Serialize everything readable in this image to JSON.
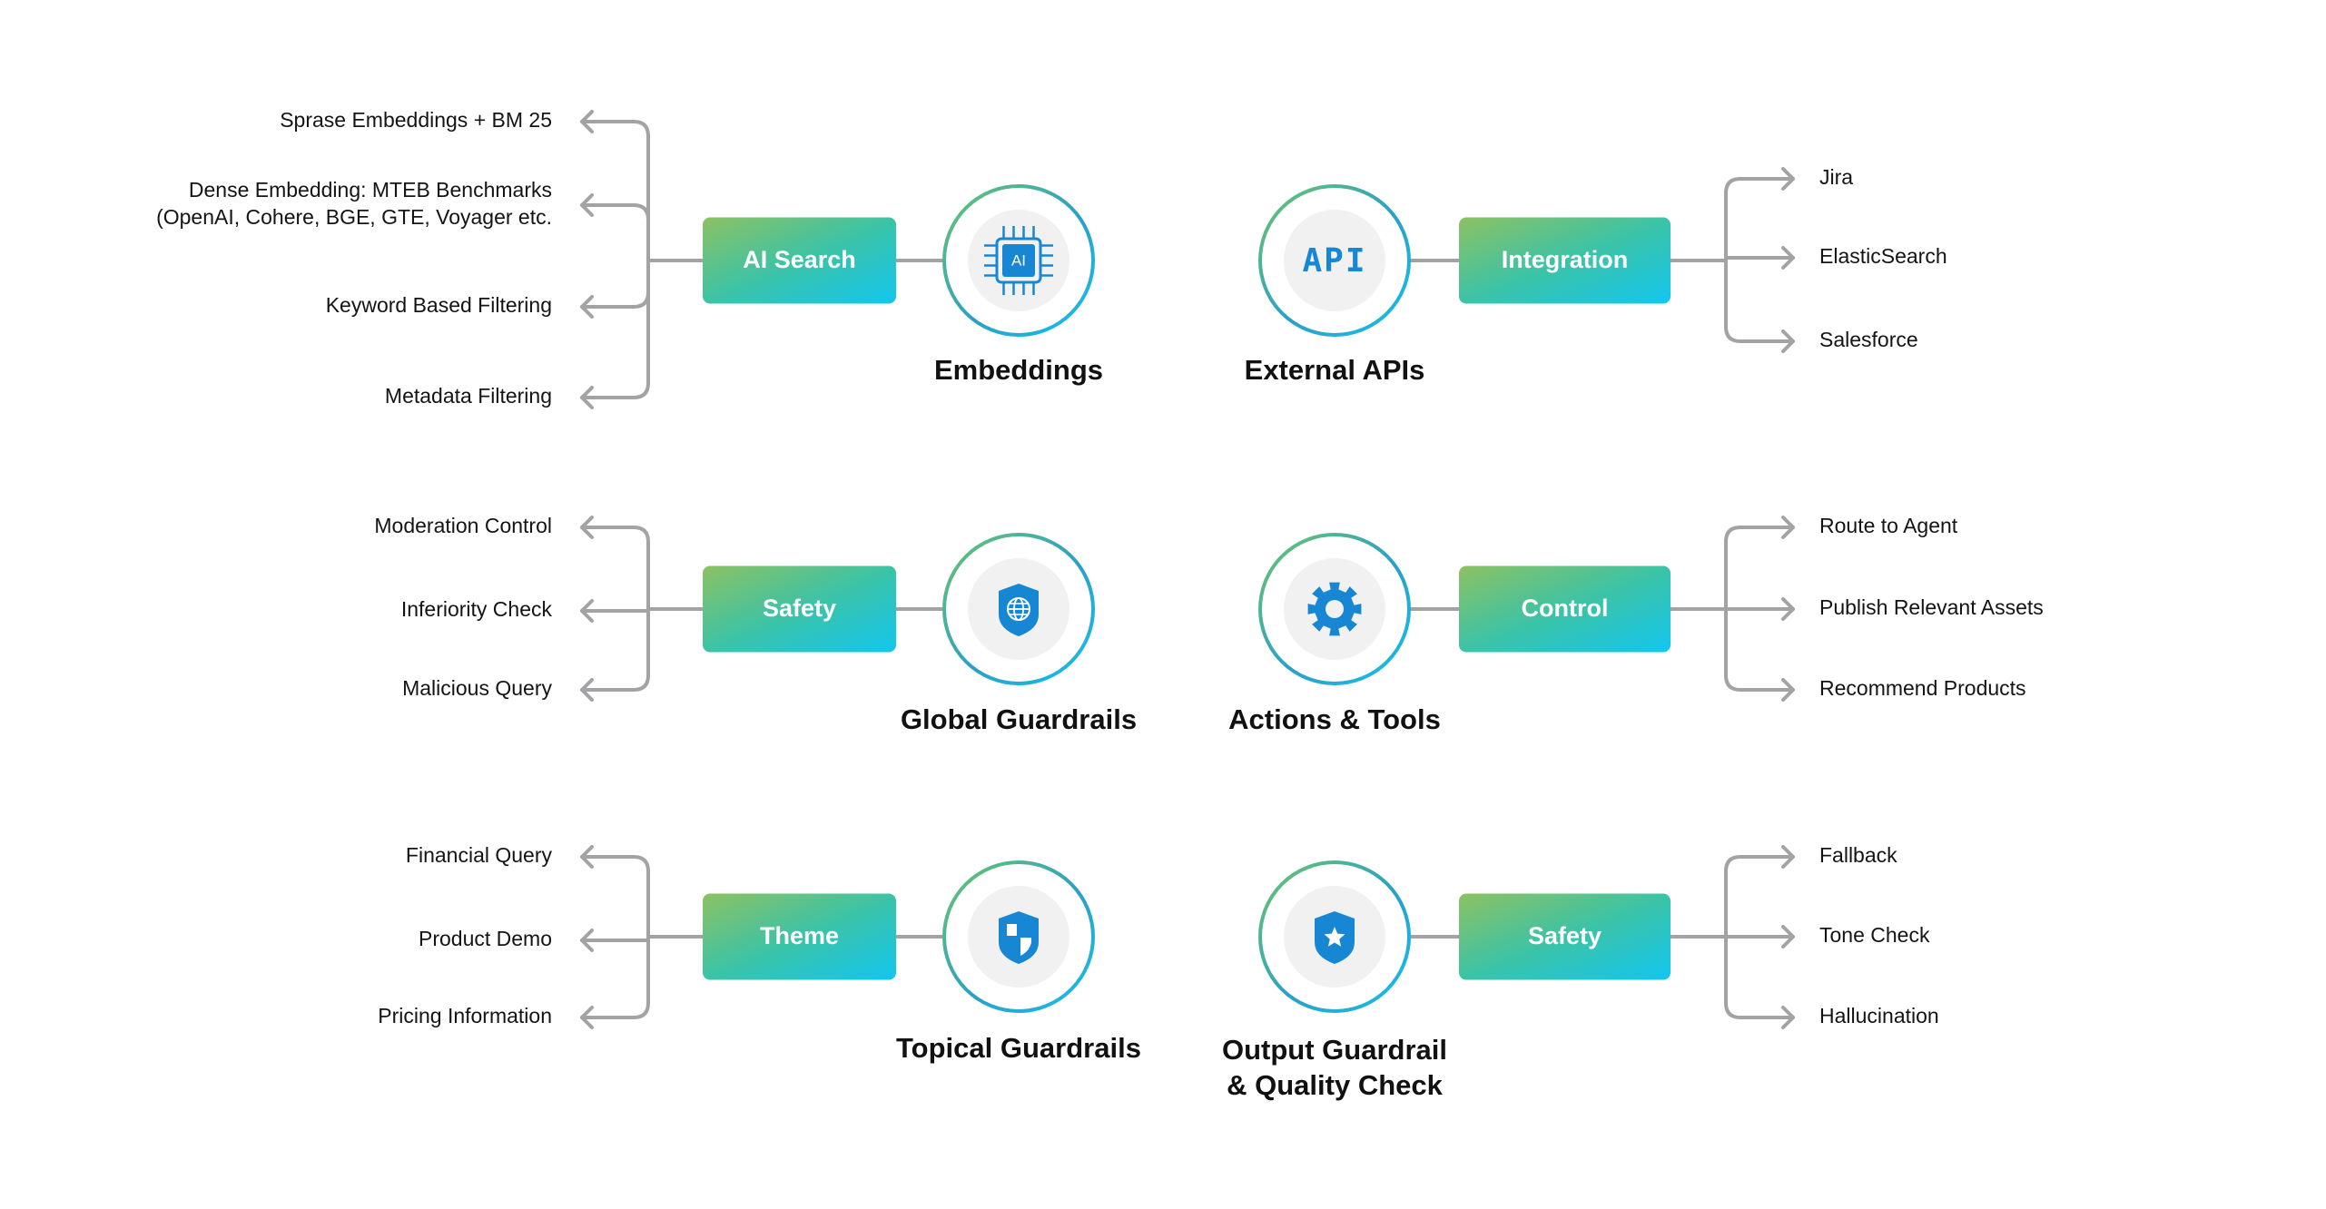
{
  "colors": {
    "gradient_start": "#8dc162",
    "gradient_mid": "#3cc3a6",
    "gradient_end": "#12c6f0",
    "ring_start": "#5cc47a",
    "ring_end": "#1ab8e6",
    "icon_blue": "#1787d3",
    "connector_gray": "#a3a3a6",
    "inner_circle": "#f1f1f1",
    "text": "#141414"
  },
  "groups": [
    {
      "id": "embeddings",
      "side": "left",
      "title_lines": [
        "Embeddings"
      ],
      "icon": "ai-chip-icon",
      "icon_text": "AI",
      "box_label": "AI Search",
      "items": [
        {
          "lines": [
            "Sprase Embeddings + BM 25"
          ]
        },
        {
          "lines": [
            "Dense Embedding: MTEB Benchmarks",
            "(OpenAI, Cohere, BGE, GTE, Voyager etc."
          ]
        },
        {
          "lines": [
            "Keyword Based Filtering"
          ]
        },
        {
          "lines": [
            "Metadata Filtering"
          ]
        }
      ]
    },
    {
      "id": "external-apis",
      "side": "right",
      "title_lines": [
        "External APIs"
      ],
      "icon": "api-icon",
      "icon_text": "API",
      "box_label": "Integration",
      "items": [
        {
          "lines": [
            "Jira"
          ]
        },
        {
          "lines": [
            "ElasticSearch"
          ]
        },
        {
          "lines": [
            "Salesforce"
          ]
        }
      ]
    },
    {
      "id": "global-guardrails",
      "side": "left",
      "title_lines": [
        "Global Guardrails"
      ],
      "icon": "shield-globe-icon",
      "box_label": "Safety",
      "items": [
        {
          "lines": [
            "Moderation Control"
          ]
        },
        {
          "lines": [
            "Inferiority Check"
          ]
        },
        {
          "lines": [
            "Malicious Query"
          ]
        }
      ]
    },
    {
      "id": "actions-tools",
      "side": "right",
      "title_lines": [
        "Actions & Tools"
      ],
      "icon": "gear-icon",
      "box_label": "Control",
      "items": [
        {
          "lines": [
            "Route to Agent"
          ]
        },
        {
          "lines": [
            "Publish Relevant Assets"
          ]
        },
        {
          "lines": [
            "Recommend Products"
          ]
        }
      ]
    },
    {
      "id": "topical-guardrails",
      "side": "left",
      "title_lines": [
        "Topical Guardrails"
      ],
      "icon": "shield-checkered-icon",
      "box_label": "Theme",
      "items": [
        {
          "lines": [
            "Financial Query"
          ]
        },
        {
          "lines": [
            "Product Demo"
          ]
        },
        {
          "lines": [
            "Pricing Information"
          ]
        }
      ]
    },
    {
      "id": "output-guardrail",
      "side": "right",
      "title_lines": [
        "Output Guardrail",
        "& Quality Check"
      ],
      "icon": "shield-star-icon",
      "box_label": "Safety",
      "items": [
        {
          "lines": [
            "Fallback"
          ]
        },
        {
          "lines": [
            "Tone Check"
          ]
        },
        {
          "lines": [
            "Hallucination"
          ]
        }
      ]
    }
  ]
}
